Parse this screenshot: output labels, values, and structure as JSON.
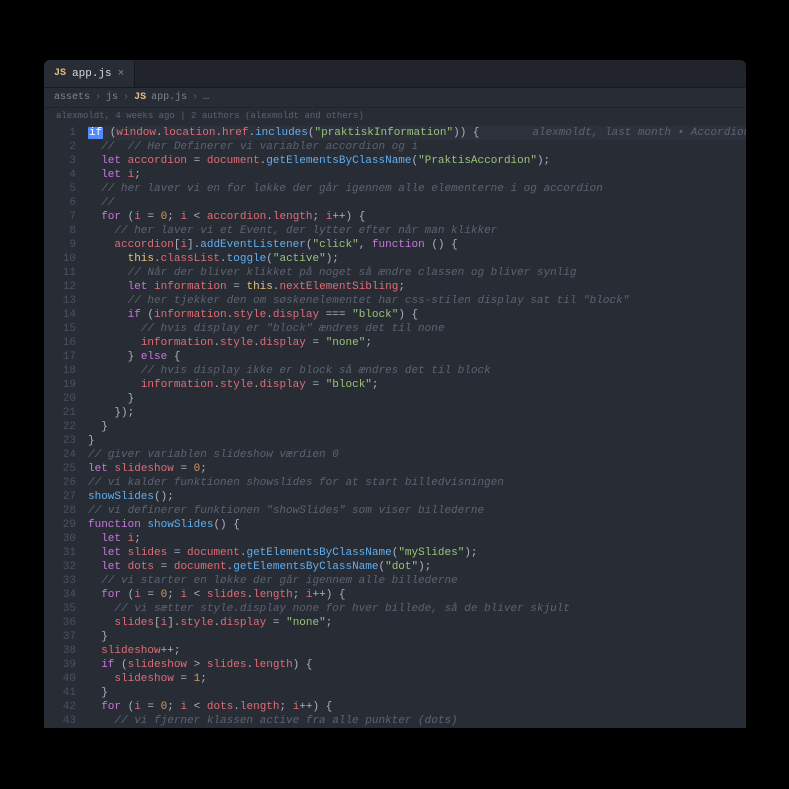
{
  "tab": {
    "icon": "JS",
    "filename": "app.js"
  },
  "breadcrumb": {
    "parts": [
      "assets",
      "js"
    ],
    "icon": "JS",
    "file": "app.js",
    "tail": "…"
  },
  "blame": "alexmoldt, 4 weeks ago | 2 authors (alexmoldt and others)",
  "inline_blame": "alexmoldt, last month • Accordions …",
  "lines": [
    {
      "n": 1,
      "hl": true,
      "tokens": [
        [
          "if-hl",
          "if"
        ],
        [
          "o",
          " ("
        ],
        [
          "v",
          "window"
        ],
        [
          "o",
          "."
        ],
        [
          "v",
          "location"
        ],
        [
          "o",
          "."
        ],
        [
          "v",
          "href"
        ],
        [
          "o",
          "."
        ],
        [
          "p",
          "includes"
        ],
        [
          "o",
          "("
        ],
        [
          "s",
          "\"praktiskInformation\""
        ],
        [
          "o",
          ")) {"
        ]
      ]
    },
    {
      "n": 2,
      "tokens": [
        [
          "o",
          "  "
        ],
        [
          "c",
          "//  // Her Definerer vi variabler accordion og i"
        ]
      ]
    },
    {
      "n": 3,
      "tokens": [
        [
          "o",
          "  "
        ],
        [
          "k",
          "let"
        ],
        [
          "o",
          " "
        ],
        [
          "v",
          "accordion"
        ],
        [
          "o",
          " = "
        ],
        [
          "v",
          "document"
        ],
        [
          "o",
          "."
        ],
        [
          "p",
          "getElementsByClassName"
        ],
        [
          "o",
          "("
        ],
        [
          "s",
          "\"PraktisAccordion\""
        ],
        [
          "o",
          ");"
        ]
      ]
    },
    {
      "n": 4,
      "tokens": [
        [
          "o",
          "  "
        ],
        [
          "k",
          "let"
        ],
        [
          "o",
          " "
        ],
        [
          "v",
          "i"
        ],
        [
          "o",
          ";"
        ]
      ]
    },
    {
      "n": 5,
      "tokens": [
        [
          "o",
          "  "
        ],
        [
          "c",
          "// her laver vi en for løkke der går igennem alle elementerne i og accordion"
        ]
      ]
    },
    {
      "n": 6,
      "tokens": [
        [
          "o",
          "  "
        ],
        [
          "c",
          "//"
        ]
      ]
    },
    {
      "n": 7,
      "tokens": [
        [
          "o",
          "  "
        ],
        [
          "k",
          "for"
        ],
        [
          "o",
          " ("
        ],
        [
          "v",
          "i"
        ],
        [
          "o",
          " = "
        ],
        [
          "n",
          "0"
        ],
        [
          "o",
          "; "
        ],
        [
          "v",
          "i"
        ],
        [
          "o",
          " < "
        ],
        [
          "v",
          "accordion"
        ],
        [
          "o",
          "."
        ],
        [
          "v",
          "length"
        ],
        [
          "o",
          "; "
        ],
        [
          "v",
          "i"
        ],
        [
          "o",
          "++) {"
        ]
      ]
    },
    {
      "n": 8,
      "tokens": [
        [
          "o",
          "    "
        ],
        [
          "c",
          "// her laver vi et Event, der lytter efter når man klikker"
        ]
      ]
    },
    {
      "n": 9,
      "tokens": [
        [
          "o",
          "    "
        ],
        [
          "v",
          "accordion"
        ],
        [
          "o",
          "["
        ],
        [
          "v",
          "i"
        ],
        [
          "o",
          "]."
        ],
        [
          "p",
          "addEventListener"
        ],
        [
          "o",
          "("
        ],
        [
          "s",
          "\"click\""
        ],
        [
          "o",
          ", "
        ],
        [
          "k",
          "function"
        ],
        [
          "o",
          " () {"
        ]
      ]
    },
    {
      "n": 10,
      "tokens": [
        [
          "o",
          "      "
        ],
        [
          "t",
          "this"
        ],
        [
          "o",
          "."
        ],
        [
          "v",
          "classList"
        ],
        [
          "o",
          "."
        ],
        [
          "p",
          "toggle"
        ],
        [
          "o",
          "("
        ],
        [
          "s",
          "\"active\""
        ],
        [
          "o",
          ");"
        ]
      ]
    },
    {
      "n": 11,
      "tokens": [
        [
          "o",
          "      "
        ],
        [
          "c",
          "// Når der bliver klikket på noget så ændre classen og bliver synlig"
        ]
      ]
    },
    {
      "n": 12,
      "tokens": [
        [
          "o",
          "      "
        ],
        [
          "k",
          "let"
        ],
        [
          "o",
          " "
        ],
        [
          "v",
          "information"
        ],
        [
          "o",
          " = "
        ],
        [
          "t",
          "this"
        ],
        [
          "o",
          "."
        ],
        [
          "v",
          "nextElementSibling"
        ],
        [
          "o",
          ";"
        ]
      ]
    },
    {
      "n": 13,
      "tokens": [
        [
          "o",
          "      "
        ],
        [
          "c",
          "// her tjekker den om søskenelementet har css-stilen display sat til \"block\""
        ]
      ]
    },
    {
      "n": 14,
      "tokens": [
        [
          "o",
          "      "
        ],
        [
          "k",
          "if"
        ],
        [
          "o",
          " ("
        ],
        [
          "v",
          "information"
        ],
        [
          "o",
          "."
        ],
        [
          "v",
          "style"
        ],
        [
          "o",
          "."
        ],
        [
          "v",
          "display"
        ],
        [
          "o",
          " === "
        ],
        [
          "s",
          "\"block\""
        ],
        [
          "o",
          ") {"
        ]
      ]
    },
    {
      "n": 15,
      "tokens": [
        [
          "o",
          "        "
        ],
        [
          "c",
          "// hvis display er \"block\" ændres det til none"
        ]
      ]
    },
    {
      "n": 16,
      "tokens": [
        [
          "o",
          "        "
        ],
        [
          "v",
          "information"
        ],
        [
          "o",
          "."
        ],
        [
          "v",
          "style"
        ],
        [
          "o",
          "."
        ],
        [
          "v",
          "display"
        ],
        [
          "o",
          " = "
        ],
        [
          "s",
          "\"none\""
        ],
        [
          "o",
          ";"
        ]
      ]
    },
    {
      "n": 17,
      "tokens": [
        [
          "o",
          "      } "
        ],
        [
          "k",
          "else"
        ],
        [
          "o",
          " {"
        ]
      ]
    },
    {
      "n": 18,
      "tokens": [
        [
          "o",
          "        "
        ],
        [
          "c",
          "// hvis display ikke er block så ændres det til block"
        ]
      ]
    },
    {
      "n": 19,
      "tokens": [
        [
          "o",
          "        "
        ],
        [
          "v",
          "information"
        ],
        [
          "o",
          "."
        ],
        [
          "v",
          "style"
        ],
        [
          "o",
          "."
        ],
        [
          "v",
          "display"
        ],
        [
          "o",
          " = "
        ],
        [
          "s",
          "\"block\""
        ],
        [
          "o",
          ";"
        ]
      ]
    },
    {
      "n": 20,
      "tokens": [
        [
          "o",
          "      }"
        ]
      ]
    },
    {
      "n": 21,
      "tokens": [
        [
          "o",
          "    });"
        ]
      ]
    },
    {
      "n": 22,
      "tokens": [
        [
          "o",
          "  }"
        ]
      ]
    },
    {
      "n": 23,
      "tokens": [
        [
          "o",
          "}"
        ]
      ]
    },
    {
      "n": 24,
      "tokens": [
        [
          "c",
          "// giver variablen slideshow værdien 0"
        ]
      ]
    },
    {
      "n": 25,
      "tokens": [
        [
          "k",
          "let"
        ],
        [
          "o",
          " "
        ],
        [
          "v",
          "slideshow"
        ],
        [
          "o",
          " = "
        ],
        [
          "n",
          "0"
        ],
        [
          "o",
          ";"
        ]
      ]
    },
    {
      "n": 26,
      "tokens": [
        [
          "c",
          "// vi kalder funktionen showslides for at start billedvisningen"
        ]
      ]
    },
    {
      "n": 27,
      "tokens": [
        [
          "p",
          "showSlides"
        ],
        [
          "o",
          "();"
        ]
      ]
    },
    {
      "n": 28,
      "tokens": [
        [
          "c",
          "// vi definerer funktionen \"showSlides\" som viser billederne"
        ]
      ]
    },
    {
      "n": 29,
      "tokens": [
        [
          "k",
          "function"
        ],
        [
          "o",
          " "
        ],
        [
          "p",
          "showSlides"
        ],
        [
          "o",
          "() {"
        ]
      ]
    },
    {
      "n": 30,
      "tokens": [
        [
          "o",
          "  "
        ],
        [
          "k",
          "let"
        ],
        [
          "o",
          " "
        ],
        [
          "v",
          "i"
        ],
        [
          "o",
          ";"
        ]
      ]
    },
    {
      "n": 31,
      "tokens": [
        [
          "o",
          "  "
        ],
        [
          "k",
          "let"
        ],
        [
          "o",
          " "
        ],
        [
          "v",
          "slides"
        ],
        [
          "o",
          " = "
        ],
        [
          "v",
          "document"
        ],
        [
          "o",
          "."
        ],
        [
          "p",
          "getElementsByClassName"
        ],
        [
          "o",
          "("
        ],
        [
          "s",
          "\"mySlides\""
        ],
        [
          "o",
          ");"
        ]
      ]
    },
    {
      "n": 32,
      "tokens": [
        [
          "o",
          "  "
        ],
        [
          "k",
          "let"
        ],
        [
          "o",
          " "
        ],
        [
          "v",
          "dots"
        ],
        [
          "o",
          " = "
        ],
        [
          "v",
          "document"
        ],
        [
          "o",
          "."
        ],
        [
          "p",
          "getElementsByClassName"
        ],
        [
          "o",
          "("
        ],
        [
          "s",
          "\"dot\""
        ],
        [
          "o",
          ");"
        ]
      ]
    },
    {
      "n": 33,
      "tokens": [
        [
          "o",
          "  "
        ],
        [
          "c",
          "// vi starter en løkke der går igennem alle billederne"
        ]
      ]
    },
    {
      "n": 34,
      "tokens": [
        [
          "o",
          "  "
        ],
        [
          "k",
          "for"
        ],
        [
          "o",
          " ("
        ],
        [
          "v",
          "i"
        ],
        [
          "o",
          " = "
        ],
        [
          "n",
          "0"
        ],
        [
          "o",
          "; "
        ],
        [
          "v",
          "i"
        ],
        [
          "o",
          " < "
        ],
        [
          "v",
          "slides"
        ],
        [
          "o",
          "."
        ],
        [
          "v",
          "length"
        ],
        [
          "o",
          "; "
        ],
        [
          "v",
          "i"
        ],
        [
          "o",
          "++) {"
        ]
      ]
    },
    {
      "n": 35,
      "tokens": [
        [
          "o",
          "    "
        ],
        [
          "c",
          "// vi sætter style.display none for hver billede, så de bliver skjult"
        ]
      ]
    },
    {
      "n": 36,
      "tokens": [
        [
          "o",
          "    "
        ],
        [
          "v",
          "slides"
        ],
        [
          "o",
          "["
        ],
        [
          "v",
          "i"
        ],
        [
          "o",
          "]."
        ],
        [
          "v",
          "style"
        ],
        [
          "o",
          "."
        ],
        [
          "v",
          "display"
        ],
        [
          "o",
          " = "
        ],
        [
          "s",
          "\"none\""
        ],
        [
          "o",
          ";"
        ]
      ]
    },
    {
      "n": 37,
      "tokens": [
        [
          "o",
          "  }"
        ]
      ]
    },
    {
      "n": 38,
      "tokens": [
        [
          "o",
          "  "
        ],
        [
          "v",
          "slideshow"
        ],
        [
          "o",
          "++;"
        ]
      ]
    },
    {
      "n": 39,
      "tokens": [
        [
          "o",
          "  "
        ],
        [
          "k",
          "if"
        ],
        [
          "o",
          " ("
        ],
        [
          "v",
          "slideshow"
        ],
        [
          "o",
          " > "
        ],
        [
          "v",
          "slides"
        ],
        [
          "o",
          "."
        ],
        [
          "v",
          "length"
        ],
        [
          "o",
          ") {"
        ]
      ]
    },
    {
      "n": 40,
      "tokens": [
        [
          "o",
          "    "
        ],
        [
          "v",
          "slideshow"
        ],
        [
          "o",
          " = "
        ],
        [
          "n",
          "1"
        ],
        [
          "o",
          ";"
        ]
      ]
    },
    {
      "n": 41,
      "tokens": [
        [
          "o",
          "  }"
        ]
      ]
    },
    {
      "n": 42,
      "tokens": [
        [
          "o",
          "  "
        ],
        [
          "k",
          "for"
        ],
        [
          "o",
          " ("
        ],
        [
          "v",
          "i"
        ],
        [
          "o",
          " = "
        ],
        [
          "n",
          "0"
        ],
        [
          "o",
          "; "
        ],
        [
          "v",
          "i"
        ],
        [
          "o",
          " < "
        ],
        [
          "v",
          "dots"
        ],
        [
          "o",
          "."
        ],
        [
          "v",
          "length"
        ],
        [
          "o",
          "; "
        ],
        [
          "v",
          "i"
        ],
        [
          "o",
          "++) {"
        ]
      ]
    },
    {
      "n": 43,
      "tokens": [
        [
          "o",
          "    "
        ],
        [
          "c",
          "// vi fjerner klassen active fra alle punkter (dots)"
        ]
      ]
    }
  ]
}
